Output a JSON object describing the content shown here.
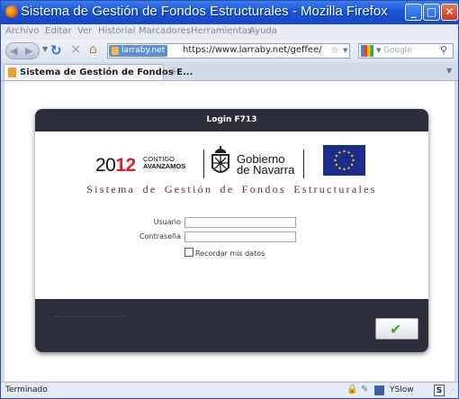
{
  "window": {
    "title": "Sistema de Gestión de Fondos Estructurales - Mozilla Firefox",
    "minimize": "_",
    "maximize": "□",
    "close": "✕"
  },
  "menu": {
    "items": [
      "Archivo",
      "Editar",
      "Ver",
      "Historial",
      "Marcadores",
      "Herramientas",
      "Ayuda"
    ]
  },
  "navbar": {
    "site_identity": "larraby.net",
    "url": "https://www.larraby.net/geffee/",
    "search_placeholder": "Google"
  },
  "tabs": [
    {
      "label": "Sistema de Gestión de Fondos E..."
    }
  ],
  "dialog": {
    "title": "Login F713",
    "logo_year_part1": "20",
    "logo_year_part2": "12",
    "logo_contigo": "CONTIGO",
    "logo_avanzamos": "AVANZAMOS",
    "gobierno_line1": "Gobierno",
    "gobierno_line2": "de Navarra",
    "system_name": "Sistema de Gestión de Fondos Estructurales",
    "user_label": "Usuario",
    "password_label": "Contraseña",
    "user_value": "",
    "password_value": "",
    "remember_label": "Recordar mis datos",
    "remember_checked": false
  },
  "status": {
    "text": "Terminado",
    "yslow": "YSlow"
  },
  "colors": {
    "titlebar": "#1a55d8",
    "dialog_frame": "#2b2f3c",
    "accent_red": "#d2232a",
    "eu_blue": "#1a2d8a",
    "eu_star": "#ffcc00"
  }
}
